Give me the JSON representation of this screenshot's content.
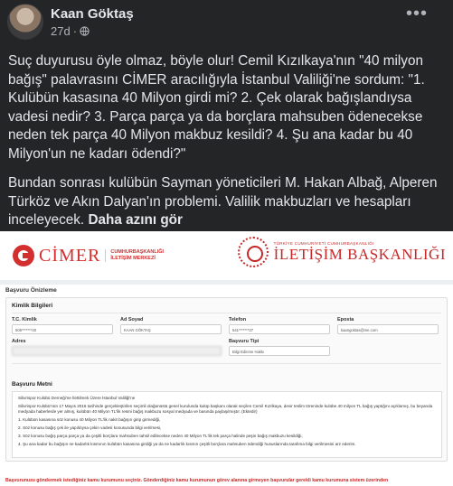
{
  "post": {
    "author": "Kaan Göktaş",
    "time": "27d",
    "privacy_icon": "globe-icon",
    "more_icon": "ellipsis-icon",
    "paragraph1": "Suç duyurusu öyle olmaz, böyle olur! Cemil Kızılkaya'nın \"40 milyon bağış\" palavrasını CİMER aracılığıyla İstanbul Valiliği'ne sordum: \"1. Kulübün kasasına 40 Milyon girdi mi? 2. Çek olarak bağışlandıysa vadesi nedir? 3. Parça parça ya da borçlara mahsuben ödenecekse neden tek parça 40 Milyon makbuz kesildi? 4. Şu ana kadar bu 40 Milyon'un ne kadarı ödendi?\"",
    "paragraph2": "Bundan sonrası kulübün Sayman yöneticileri M. Hakan Albağ, Alperen Türköz ve Akın Dalyan'ın problemi. Valilik makbuzları ve hesapları inceleyecek.",
    "see_more": "Daha azını gör"
  },
  "doc": {
    "cimer_word": "CİMER",
    "cimer_sub_1": "CUMHURBAŞKANLIĞI",
    "cimer_sub_2": "İLETİŞİM MERKEZİ",
    "ib_small": "TÜRKİYE CUMHURİYETİ CUMHURBAŞKANLIĞI",
    "ib_big": "İLETİŞİM BAŞKANLIĞI",
    "preview_title": "Başvuru Önizleme",
    "identity_title": "Kimlik Bilgileri",
    "labels": {
      "tc": "T.C. Kimlik",
      "name": "Ad Soyad",
      "phone": "Telefon",
      "email": "Eposta",
      "address": "Adres",
      "type": "Başvuru Tipi"
    },
    "values": {
      "tc": "505*******40",
      "name": "KAAN GÖKTAŞ",
      "phone": "541*******37",
      "email": "kaangoktas@me.com",
      "type": "Bilgi Edinme Hakkı"
    },
    "message_title": "Başvuru Metni",
    "message_lines": [
      "Silivrispor Kulübü Derneği'ne İlettilmek Üzere İstanbul Valiliği'ne",
      "Silivrispor Kulübü'nün 17 Mayıs 2016 tarihinde gerçekleştirilen seçimli olağanüstü genel kurulunda kulüp başkanı olarak seçilen Cemil Kızılkaya, devir teslim töreninde kulübe 40 milyon TL bağış yaptığını açıklamış, bu beyanda medyada haberlerde yer almış, kulübün 40 Milyon TL'lik resmi bağış makbuzu sosyal medyada ve basında paylaşılmıştır. (Ektedir)",
      "1. Kulübün kasasına söz konusu 40 Milyon TL'lik nakit bağışın girip girmediği,",
      "2. Söz konusu bağış çek ile yapıldıysa çekin vadesi konusunda bilgi verilmesi,",
      "3. Söz konusu bağış parça parça ya da çeşitli borçlara mahsuben tahsil edilecekse neden 40 Milyon TL'lik tek parça halinde peşin bağış makbuzu kesildiği,",
      "4. Şu ana kadar bu bağışın ne kadarlık kısmının kulübün kasasına girdiği ya da ne kadarlık kısmın çeşitli borçlara mahsuben ödendiği hususlarında tarafıma bilgi verilmesini arz ederim."
    ],
    "warning": "Başvurunuzu göndermek istediğiniz kamu kurumunu seçiniz. Gönderdiğiniz kamu kurumunun görev alanına girmeyen başvurular gerekli kamu kurumuna sistem üzerinden"
  },
  "colors": {
    "fb_bg": "#242526",
    "cimer_red": "#d32f2f"
  }
}
